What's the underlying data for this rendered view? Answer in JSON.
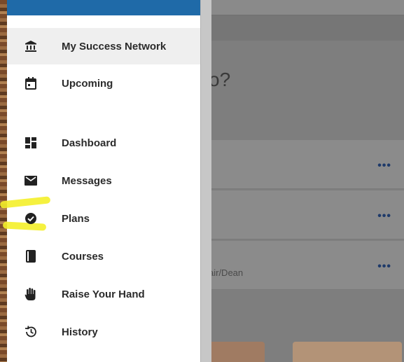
{
  "drawer": {
    "items": [
      {
        "label": "My Success Network",
        "icon": "bank-icon",
        "active": true
      },
      {
        "label": "Upcoming",
        "icon": "calendar-icon"
      },
      {
        "label": "Dashboard",
        "icon": "dashboard-icon"
      },
      {
        "label": "Messages",
        "icon": "envelope-icon"
      },
      {
        "label": "Plans",
        "icon": "check-circle-icon"
      },
      {
        "label": "Courses",
        "icon": "book-icon"
      },
      {
        "label": "Raise Your Hand",
        "icon": "hand-icon"
      },
      {
        "label": "History",
        "icon": "history-icon"
      }
    ]
  },
  "background": {
    "question_fragment": "o?",
    "card_subtext": "air/Dean",
    "more_symbol": "•••"
  },
  "colors": {
    "header": "#1f6aa8",
    "highlight": "#f4ef2a"
  }
}
